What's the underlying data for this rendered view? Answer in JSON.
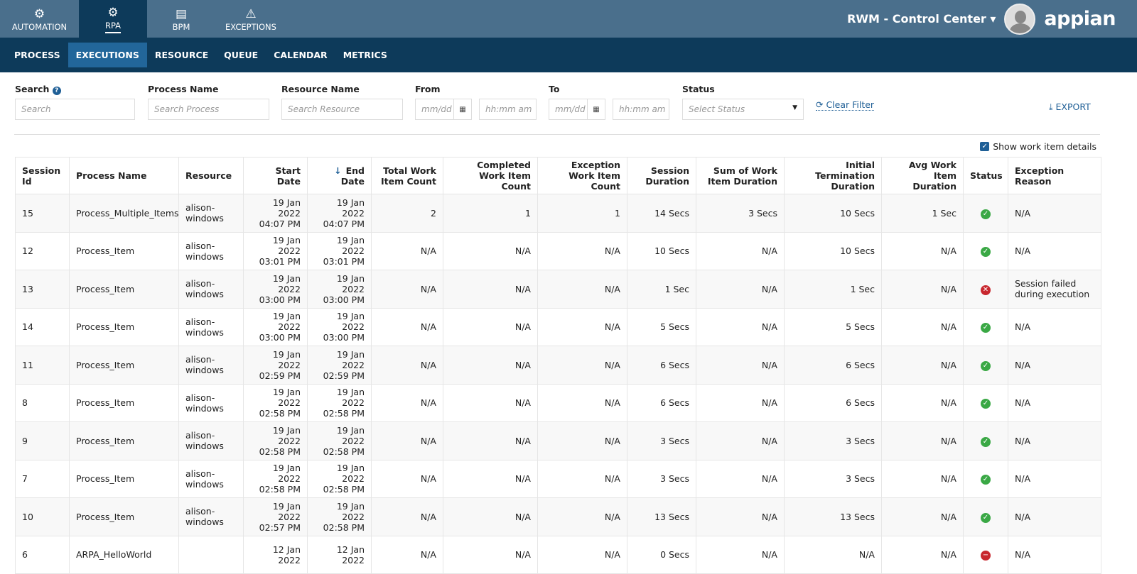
{
  "top_tabs": [
    {
      "label": "AUTOMATION",
      "icon": "gear-icon",
      "glyph": "⚙"
    },
    {
      "label": "RPA",
      "icon": "gears-icon",
      "glyph": "⚙"
    },
    {
      "label": "BPM",
      "icon": "archive-icon",
      "glyph": "▤"
    },
    {
      "label": "EXCEPTIONS",
      "icon": "warning-icon",
      "glyph": "⚠"
    }
  ],
  "app_title": "RWM - Control Center ▾",
  "logo": "appian",
  "sub_tabs": [
    "PROCESS",
    "EXECUTIONS",
    "RESOURCE",
    "QUEUE",
    "CALENDAR",
    "METRICS"
  ],
  "filters": {
    "search_label": "Search",
    "search_ph": "Search",
    "process_label": "Process Name",
    "process_ph": "Search Process",
    "resource_label": "Resource Name",
    "resource_ph": "Search Resource",
    "from_label": "From",
    "to_label": "To",
    "date_ph": "mm/dd",
    "time_ph": "hh:mm am",
    "status_label": "Status",
    "status_ph": "Select Status",
    "clear": "⟳ Clear Filter",
    "export": "⤓ EXPORT"
  },
  "show_details": "Show work item details",
  "colors": {
    "header": "#4a6f8c",
    "subnav": "#0d3a5a",
    "accent": "#1f5f96",
    "success": "#3aa845",
    "error": "#c8272e"
  },
  "columns": [
    "Session Id",
    "Process Name",
    "Resource",
    "Start Date",
    "End Date",
    "Total Work Item Count",
    "Completed Work Item Count",
    "Exception Work Item Count",
    "Session Duration",
    "Sum of Work Item Duration",
    "Initial Termination Duration",
    "Avg Work Item Duration",
    "Status",
    "Exception Reason"
  ],
  "rows": [
    [
      "15",
      "Process_Multiple_Items",
      "alison-windows",
      "19 Jan 2022 04:07 PM",
      "19 Jan 2022 04:07 PM",
      "2",
      "1",
      "1",
      "14 Secs",
      "3 Secs",
      "10 Secs",
      "1 Sec",
      "success",
      "N/A"
    ],
    [
      "12",
      "Process_Item",
      "alison-windows",
      "19 Jan 2022 03:01 PM",
      "19 Jan 2022 03:01 PM",
      "N/A",
      "N/A",
      "N/A",
      "10 Secs",
      "N/A",
      "10 Secs",
      "N/A",
      "success",
      "N/A"
    ],
    [
      "13",
      "Process_Item",
      "alison-windows",
      "19 Jan 2022 03:00 PM",
      "19 Jan 2022 03:00 PM",
      "N/A",
      "N/A",
      "N/A",
      "1 Sec",
      "N/A",
      "1 Sec",
      "N/A",
      "failed",
      "Session failed during execution"
    ],
    [
      "14",
      "Process_Item",
      "alison-windows",
      "19 Jan 2022 03:00 PM",
      "19 Jan 2022 03:00 PM",
      "N/A",
      "N/A",
      "N/A",
      "5 Secs",
      "N/A",
      "5 Secs",
      "N/A",
      "success",
      "N/A"
    ],
    [
      "11",
      "Process_Item",
      "alison-windows",
      "19 Jan 2022 02:59 PM",
      "19 Jan 2022 02:59 PM",
      "N/A",
      "N/A",
      "N/A",
      "6 Secs",
      "N/A",
      "6 Secs",
      "N/A",
      "success",
      "N/A"
    ],
    [
      "8",
      "Process_Item",
      "alison-windows",
      "19 Jan 2022 02:58 PM",
      "19 Jan 2022 02:58 PM",
      "N/A",
      "N/A",
      "N/A",
      "6 Secs",
      "N/A",
      "6 Secs",
      "N/A",
      "success",
      "N/A"
    ],
    [
      "9",
      "Process_Item",
      "alison-windows",
      "19 Jan 2022 02:58 PM",
      "19 Jan 2022 02:58 PM",
      "N/A",
      "N/A",
      "N/A",
      "3 Secs",
      "N/A",
      "3 Secs",
      "N/A",
      "success",
      "N/A"
    ],
    [
      "7",
      "Process_Item",
      "alison-windows",
      "19 Jan 2022 02:58 PM",
      "19 Jan 2022 02:58 PM",
      "N/A",
      "N/A",
      "N/A",
      "3 Secs",
      "N/A",
      "3 Secs",
      "N/A",
      "success",
      "N/A"
    ],
    [
      "10",
      "Process_Item",
      "alison-windows",
      "19 Jan 2022 02:57 PM",
      "19 Jan 2022 02:58 PM",
      "N/A",
      "N/A",
      "N/A",
      "13 Secs",
      "N/A",
      "13 Secs",
      "N/A",
      "success",
      "N/A"
    ],
    [
      "6",
      "ARPA_HelloWorld",
      "",
      "12 Jan 2022",
      "12 Jan 2022",
      "N/A",
      "N/A",
      "N/A",
      "0 Secs",
      "N/A",
      "N/A",
      "N/A",
      "stopped",
      "N/A"
    ]
  ]
}
